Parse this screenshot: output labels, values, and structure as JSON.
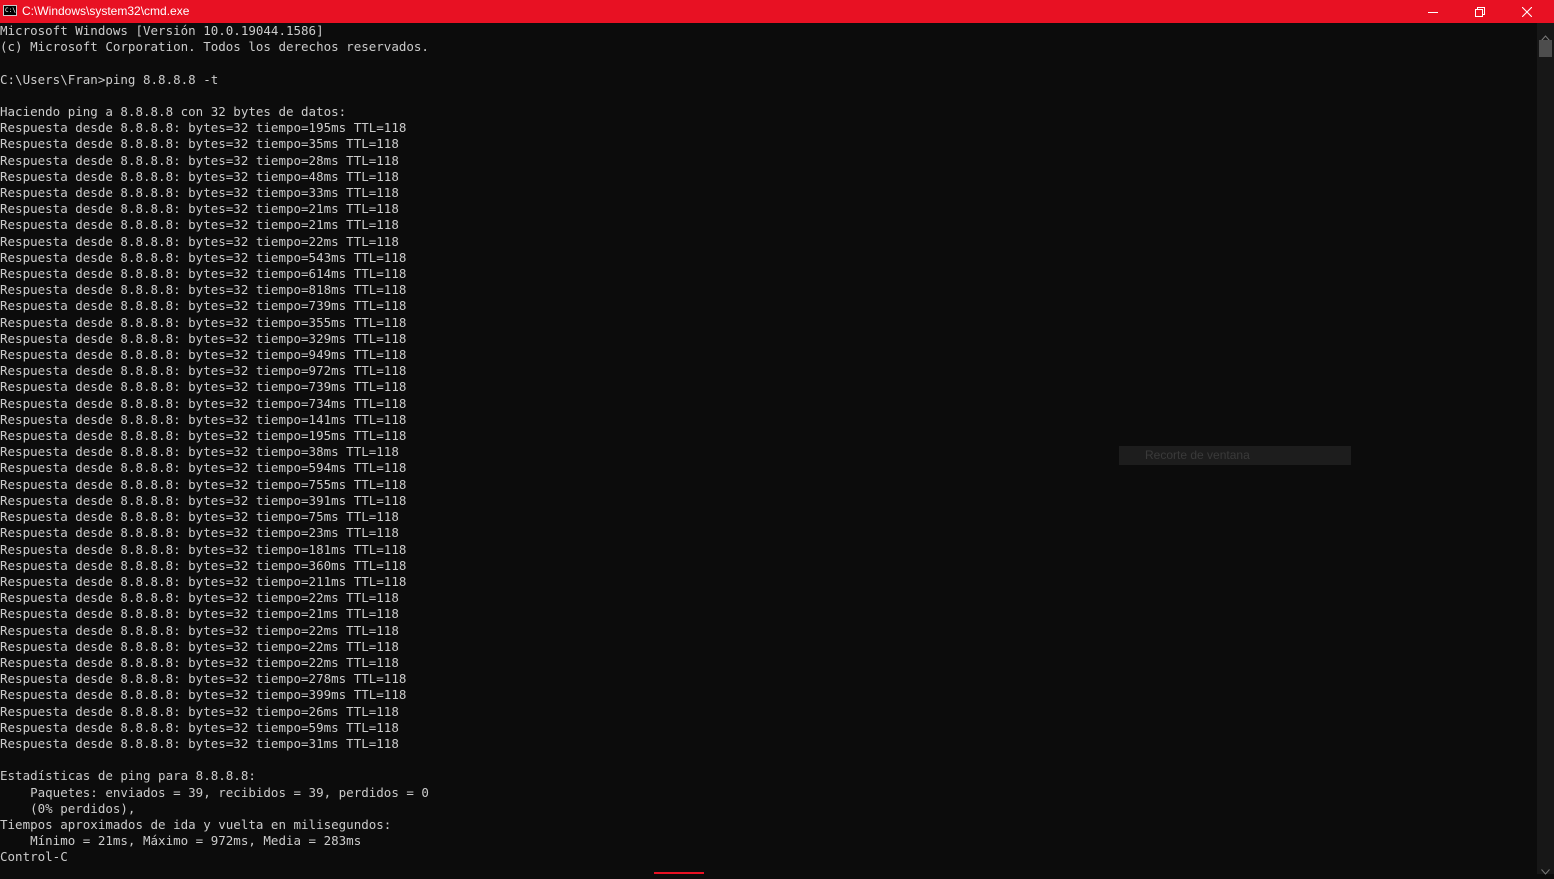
{
  "window": {
    "title": "C:\\Windows\\system32\\cmd.exe",
    "icon": "cmd-icon",
    "icon_text": "C:\\",
    "titlebar_color": "#e81123",
    "controls": {
      "minimize_icon": "minimize-icon",
      "maximize_icon": "restore-icon",
      "close_icon": "close-icon"
    }
  },
  "console": {
    "background": "#0c0c0c",
    "foreground": "#cccccc",
    "lines": [
      "Microsoft Windows [Versión 10.0.19044.1586]",
      "(c) Microsoft Corporation. Todos los derechos reservados.",
      "",
      "C:\\Users\\Fran>ping 8.8.8.8 -t",
      "",
      "Haciendo ping a 8.8.8.8 con 32 bytes de datos:",
      "Respuesta desde 8.8.8.8: bytes=32 tiempo=195ms TTL=118",
      "Respuesta desde 8.8.8.8: bytes=32 tiempo=35ms TTL=118",
      "Respuesta desde 8.8.8.8: bytes=32 tiempo=28ms TTL=118",
      "Respuesta desde 8.8.8.8: bytes=32 tiempo=48ms TTL=118",
      "Respuesta desde 8.8.8.8: bytes=32 tiempo=33ms TTL=118",
      "Respuesta desde 8.8.8.8: bytes=32 tiempo=21ms TTL=118",
      "Respuesta desde 8.8.8.8: bytes=32 tiempo=21ms TTL=118",
      "Respuesta desde 8.8.8.8: bytes=32 tiempo=22ms TTL=118",
      "Respuesta desde 8.8.8.8: bytes=32 tiempo=543ms TTL=118",
      "Respuesta desde 8.8.8.8: bytes=32 tiempo=614ms TTL=118",
      "Respuesta desde 8.8.8.8: bytes=32 tiempo=818ms TTL=118",
      "Respuesta desde 8.8.8.8: bytes=32 tiempo=739ms TTL=118",
      "Respuesta desde 8.8.8.8: bytes=32 tiempo=355ms TTL=118",
      "Respuesta desde 8.8.8.8: bytes=32 tiempo=329ms TTL=118",
      "Respuesta desde 8.8.8.8: bytes=32 tiempo=949ms TTL=118",
      "Respuesta desde 8.8.8.8: bytes=32 tiempo=972ms TTL=118",
      "Respuesta desde 8.8.8.8: bytes=32 tiempo=739ms TTL=118",
      "Respuesta desde 8.8.8.8: bytes=32 tiempo=734ms TTL=118",
      "Respuesta desde 8.8.8.8: bytes=32 tiempo=141ms TTL=118",
      "Respuesta desde 8.8.8.8: bytes=32 tiempo=195ms TTL=118",
      "Respuesta desde 8.8.8.8: bytes=32 tiempo=38ms TTL=118",
      "Respuesta desde 8.8.8.8: bytes=32 tiempo=594ms TTL=118",
      "Respuesta desde 8.8.8.8: bytes=32 tiempo=755ms TTL=118",
      "Respuesta desde 8.8.8.8: bytes=32 tiempo=391ms TTL=118",
      "Respuesta desde 8.8.8.8: bytes=32 tiempo=75ms TTL=118",
      "Respuesta desde 8.8.8.8: bytes=32 tiempo=23ms TTL=118",
      "Respuesta desde 8.8.8.8: bytes=32 tiempo=181ms TTL=118",
      "Respuesta desde 8.8.8.8: bytes=32 tiempo=360ms TTL=118",
      "Respuesta desde 8.8.8.8: bytes=32 tiempo=211ms TTL=118",
      "Respuesta desde 8.8.8.8: bytes=32 tiempo=22ms TTL=118",
      "Respuesta desde 8.8.8.8: bytes=32 tiempo=21ms TTL=118",
      "Respuesta desde 8.8.8.8: bytes=32 tiempo=22ms TTL=118",
      "Respuesta desde 8.8.8.8: bytes=32 tiempo=22ms TTL=118",
      "Respuesta desde 8.8.8.8: bytes=32 tiempo=22ms TTL=118",
      "Respuesta desde 8.8.8.8: bytes=32 tiempo=278ms TTL=118",
      "Respuesta desde 8.8.8.8: bytes=32 tiempo=399ms TTL=118",
      "Respuesta desde 8.8.8.8: bytes=32 tiempo=26ms TTL=118",
      "Respuesta desde 8.8.8.8: bytes=32 tiempo=59ms TTL=118",
      "Respuesta desde 8.8.8.8: bytes=32 tiempo=31ms TTL=118",
      "",
      "Estadísticas de ping para 8.8.8.8:",
      "    Paquetes: enviados = 39, recibidos = 39, perdidos = 0",
      "    (0% perdidos),",
      "Tiempos aproximados de ida y vuelta en milisegundos:",
      "    Mínimo = 21ms, Máximo = 972ms, Media = 283ms",
      "Control-C"
    ]
  },
  "tooltip": {
    "text": "Recorte de ventana"
  },
  "scrollbar": {
    "up_icon": "scroll-up-arrow-icon",
    "down_icon": "scroll-down-arrow-icon"
  }
}
